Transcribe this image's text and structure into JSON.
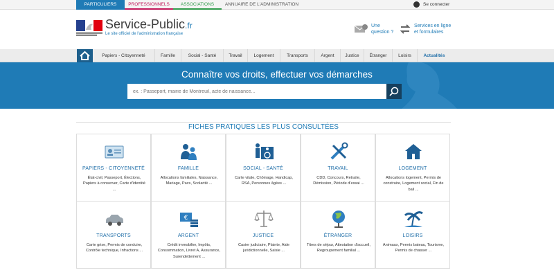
{
  "topbar": {
    "tabs": [
      {
        "label": "PARTICULIERS",
        "color": "#1f7bb6"
      },
      {
        "label": "PROFESSIONNELS",
        "color": "#c2185b"
      },
      {
        "label": "ASSOCIATIONS",
        "color": "#2e9a4a"
      },
      {
        "label": "ANNUAIRE DE L'ADMINISTRATION",
        "color": ""
      }
    ],
    "connect_label": "Se connecter"
  },
  "header": {
    "logo_title": "Service-Public",
    "logo_tld": ".fr",
    "logo_subtitle": "Le site officiel de l'administration française",
    "question_line1": "Une",
    "question_line2": "question ?",
    "services_line1": "Services en ligne",
    "services_line2": "et formulaires"
  },
  "nav": {
    "items": [
      "Papiers - Citoyenneté",
      "Famille",
      "Social - Santé",
      "Travail",
      "Logement",
      "Transports",
      "Argent",
      "Justice",
      "Étranger",
      "Loisirs",
      "Actualités"
    ]
  },
  "hero": {
    "title": "Connaître vos droits, effectuer vos démarches",
    "search_placeholder": "ex. : Passeport, mairie de Montreuil, acte de naissance..."
  },
  "section": {
    "title": "FICHES PRATIQUES LES PLUS CONSULTÉES"
  },
  "cards": [
    {
      "title": "PAPIERS - CITOYENNETÉ",
      "desc": "État-civil, Passeport, Élections, Papiers à conserver, Carte d'identité ...",
      "icon": "id-card-icon"
    },
    {
      "title": "FAMILLE",
      "desc": "Allocations familiales, Naissance, Mariage, Pacs, Scolarité ...",
      "icon": "family-icon"
    },
    {
      "title": "SOCIAL - SANTÉ",
      "desc": "Carte vitale, Chômage, Handicap, RSA, Personnes âgées ...",
      "icon": "wheelchair-icon"
    },
    {
      "title": "TRAVAIL",
      "desc": "CDD, Concours, Retraite, Démission, Période d'essai ...",
      "icon": "tools-icon"
    },
    {
      "title": "LOGEMENT",
      "desc": "Allocations logement, Permis de construire, Logement social, Fin de bail ...",
      "icon": "house-icon"
    },
    {
      "title": "TRANSPORTS",
      "desc": "Carte grise, Permis de conduire, Contrôle technique, Infractions ...",
      "icon": "car-icon"
    },
    {
      "title": "ARGENT",
      "desc": "Crédit immobilier, Impôts, Consommation, Livret A, Assurance, Surendettement ...",
      "icon": "money-icon"
    },
    {
      "title": "JUSTICE",
      "desc": "Casier judiciaire, Plainte, Aide juridictionnelle, Saisie ...",
      "icon": "scales-icon"
    },
    {
      "title": "ÉTRANGER",
      "desc": "Titres de séjour, Attestation d'accueil, Regroupement familial ...",
      "icon": "globe-icon"
    },
    {
      "title": "LOISIRS",
      "desc": "Animaux, Permis bateau, Tourisme, Permis de chasser ...",
      "icon": "palm-tree-icon"
    }
  ]
}
